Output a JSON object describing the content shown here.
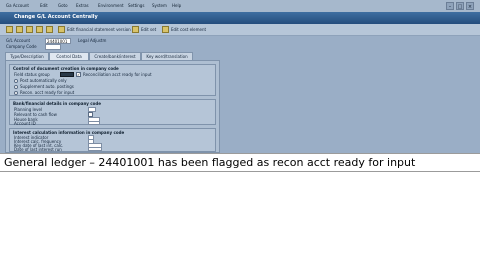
{
  "menubar": {
    "items": [
      "Ga Account",
      "Edit",
      "Goto",
      "Extras",
      "Environment",
      "Settings",
      "System",
      "Help"
    ]
  },
  "titlebar": {
    "title": "Change G/L Account Centrally"
  },
  "toolbar": {
    "items": [
      "Edit financial statement version",
      "Edit set",
      "Edit cost element"
    ]
  },
  "header": {
    "account_label": "G/L Account",
    "account_value": "24401001",
    "account_desc": "Legal Adjustm",
    "company_label": "Company Code"
  },
  "tabs": [
    "Type/Description",
    "Control Data",
    "Create/bank/interest",
    "Key word/translation"
  ],
  "groups": {
    "doc_creation": {
      "title": "Control of document creation in company code",
      "field_status_label": "Field status group",
      "recon_label": "Reconciliation acct ready for input",
      "options": [
        "Post automatically only",
        "Supplement auto. postings",
        "Recon. acct ready for input"
      ]
    },
    "bank": {
      "title": "Bank/financial details in company code",
      "rows": [
        "Planning level",
        "Relevant to cash flow",
        "House bank",
        "Account ID"
      ]
    },
    "interest": {
      "title": "Interest calculation information in company code",
      "rows": [
        "Interest indicator",
        "Interest calc. frequency",
        "Key date of last int. calc.",
        "Date of last interest run"
      ]
    }
  },
  "caption": {
    "text": "General ledger – 24401001 has been flagged as recon acct ready for input"
  },
  "colors": {
    "sap_background": "#9aaec6",
    "title_bar": "#2f5d8e"
  }
}
